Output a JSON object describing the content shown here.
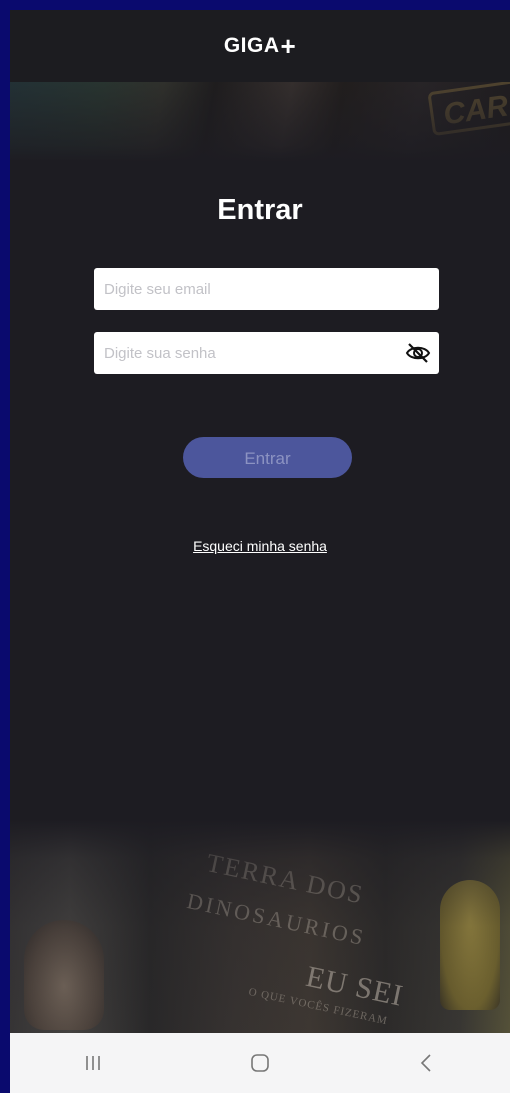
{
  "header": {
    "logo_text": "GIGA",
    "logo_plus": "+"
  },
  "login": {
    "title": "Entrar",
    "email_placeholder": "Digite seu email",
    "password_placeholder": "Digite sua senha",
    "submit_label": "Entrar",
    "forgot_link": "Esqueci minha senha"
  },
  "icons": {
    "password_toggle": "eye-off-icon",
    "nav_recents": "recents-icon",
    "nav_home": "home-icon",
    "nav_back": "back-icon"
  },
  "colors": {
    "background": "#1d1c22",
    "button": "#4c569c",
    "button_text": "#8c93c2",
    "frame": "#0a0a6e"
  }
}
